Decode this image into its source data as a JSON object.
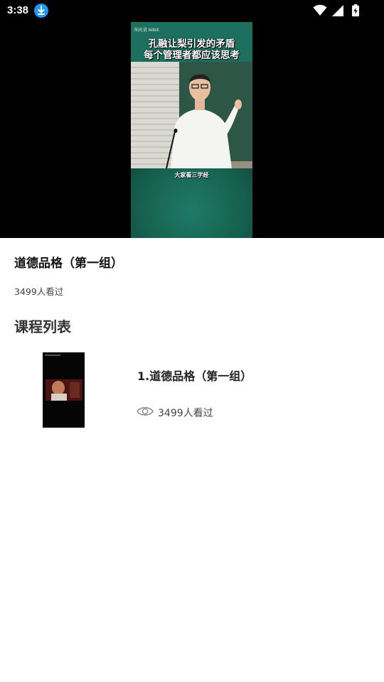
{
  "status_bar": {
    "time": "3:38",
    "icons": [
      "download-notification-icon",
      "wifi-icon",
      "cellular-signal-icon",
      "battery-charging-icon"
    ]
  },
  "video": {
    "brand": "阳光说  bilibili",
    "title_line1": "孔融让梨引发的矛盾",
    "title_line2": "每个管理者都应该思考",
    "caption": "大家看三字经"
  },
  "course": {
    "title": "道德品格（第一组）",
    "views": "3499人看过"
  },
  "section": {
    "title": "课程列表"
  },
  "lessons": [
    {
      "title": "1.道德品格（第一组）",
      "views": "3499人看过",
      "icon": "eye-icon"
    }
  ],
  "colors": {
    "video_teal": "#1d6f5f",
    "download_blue": "#2196f3",
    "status_bg": "#000000"
  }
}
